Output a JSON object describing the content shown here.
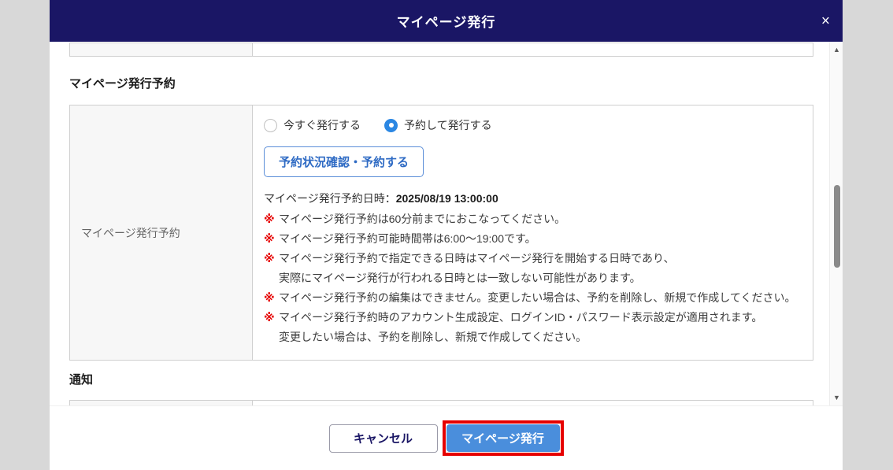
{
  "modal": {
    "title": "マイページ発行",
    "close_label": "×"
  },
  "sections": {
    "reservation_heading": "マイページ発行予約",
    "notification_heading": "通知"
  },
  "reservation": {
    "row_label": "マイページ発行予約",
    "radio_options": [
      {
        "label": "今すぐ発行する",
        "selected": false
      },
      {
        "label": "予約して発行する",
        "selected": true
      }
    ],
    "check_button_label": "予約状況確認・予約する",
    "datetime_label": "マイページ発行予約日時：",
    "datetime_value": "2025/08/19 13:00:00",
    "note_marker": "※",
    "notes": [
      {
        "lines": [
          "マイページ発行予約は60分前までにおこなってください。"
        ]
      },
      {
        "lines": [
          "マイページ発行予約可能時間帯は6:00～19:00です。"
        ]
      },
      {
        "lines": [
          "マイページ発行予約で指定できる日時はマイページ発行を開始する日時であり、",
          "実際にマイページ発行が行われる日時とは一致しない可能性があります。"
        ]
      },
      {
        "lines": [
          "マイページ発行予約の編集はできません。変更したい場合は、予約を削除し、新規で作成してください。"
        ]
      },
      {
        "lines": [
          "マイページ発行予約時のアカウント生成設定、ログインID・パスワード表示設定が適用されます。",
          "変更したい場合は、予約を削除し、新規で作成してください。"
        ]
      }
    ]
  },
  "footer": {
    "cancel_label": "キャンセル",
    "submit_label": "マイページ発行"
  },
  "colors": {
    "header_navy": "#1a1665",
    "accent_blue": "#2f6bc4",
    "radio_blue": "#2b87e3",
    "submit_blue": "#4a8edc",
    "annotation_red": "#e60000",
    "note_marker_red": "#e60000",
    "backdrop_gray": "#d8d8d8",
    "table_border": "#cfcfcf",
    "row_label_bg": "#f7f7f7"
  }
}
